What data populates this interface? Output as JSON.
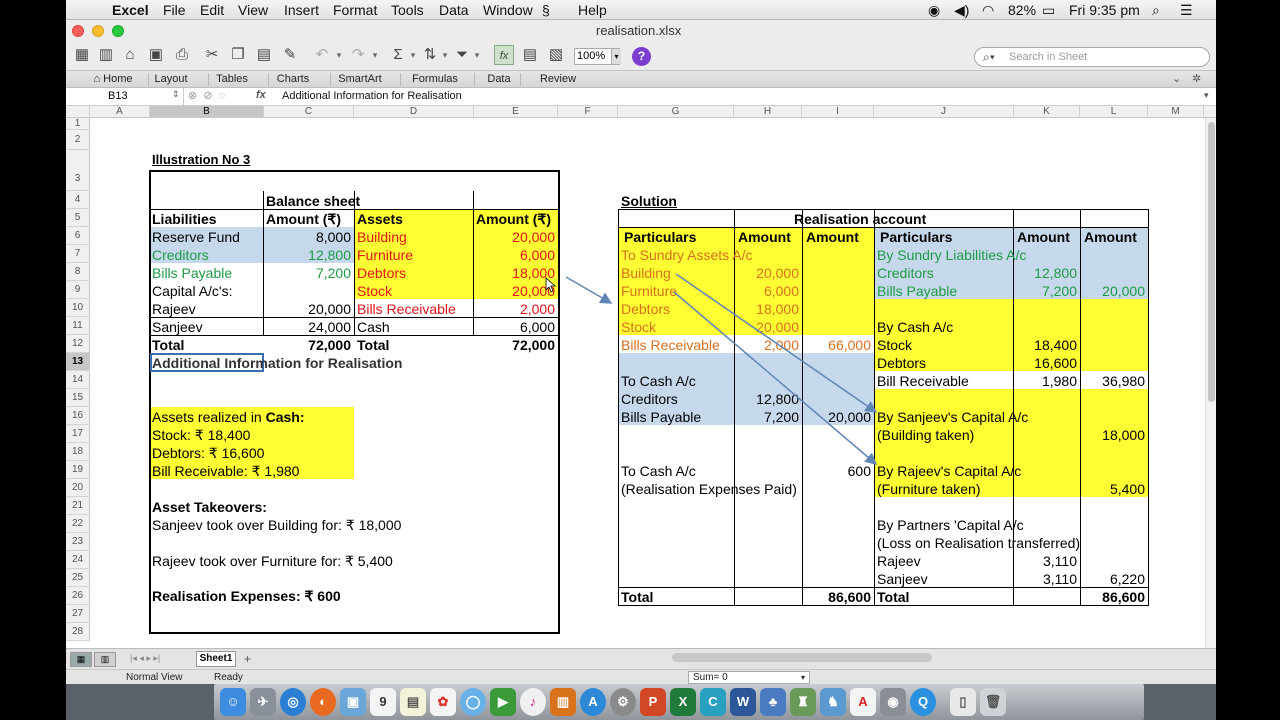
{
  "menubar": {
    "app": "Excel",
    "items": [
      "File",
      "Edit",
      "View",
      "Insert",
      "Format",
      "Tools",
      "Data",
      "Window",
      "Help"
    ],
    "battery": "82%",
    "clock": "Fri 9:35 pm"
  },
  "window": {
    "title": "realisation.xlsx"
  },
  "toolbar": {
    "zoom": "100%",
    "search_placeholder": "Search in Sheet"
  },
  "ribbon": {
    "tabs": [
      "Home",
      "Layout",
      "Tables",
      "Charts",
      "SmartArt",
      "Formulas",
      "Data",
      "Review"
    ]
  },
  "formula_bar": {
    "name_box": "B13",
    "fx": "fx",
    "content": "Additional Information for Realisation"
  },
  "columns": [
    "A",
    "B",
    "C",
    "D",
    "E",
    "F",
    "G",
    "H",
    "I",
    "J",
    "K",
    "L",
    "M"
  ],
  "rows": [
    "1",
    "2",
    "3",
    "4",
    "5",
    "6",
    "7",
    "8",
    "9",
    "10",
    "11",
    "12",
    "13",
    "14",
    "15",
    "16",
    "17",
    "18",
    "19",
    "20",
    "21",
    "22",
    "23",
    "24",
    "25",
    "26",
    "27",
    "28"
  ],
  "left": {
    "illustration": "Illustration No 3",
    "bs_title": "Balance sheet",
    "hdr_liabilities": "Liabilities",
    "hdr_amount1": "Amount (₹)",
    "hdr_assets": "Assets",
    "hdr_amount2": "Amount (₹)",
    "r5": [
      "Reserve Fund",
      "8,000",
      "Building",
      "20,000"
    ],
    "r6": [
      "Creditors",
      "12,800",
      "Furniture",
      "6,000"
    ],
    "r7": [
      "Bills Payable",
      "7,200",
      "Debtors",
      "18,000"
    ],
    "r8": [
      "Capital A/c's:",
      "",
      "Stock",
      "20,000"
    ],
    "r9": [
      "Rajeev",
      "20,000",
      "Bills Receivable",
      "2,000"
    ],
    "r10": [
      "Sanjeev",
      "24,000",
      "Cash",
      "6,000"
    ],
    "r11": [
      "Total",
      "72,000",
      "Total",
      "72,000"
    ],
    "addl_info": "Additional Information for Realisation",
    "assets_realized_pre": "Assets realized in ",
    "assets_realized_cash": "Cash:",
    "stock": "Stock: ₹ 18,400",
    "debtors": "Debtors: ₹ 16,600",
    "bill_rec": "Bill Receivable: ₹ 1,980",
    "asset_takeovers": "Asset Takeovers:",
    "sanjeev_took": "Sanjeev took over Building for: ₹ 18,000",
    "rajeev_took": "Rajeev took over Furniture for: ₹ 5,400",
    "real_exp": "Realisation Expenses: ₹ 600"
  },
  "right": {
    "solution": "Solution",
    "ra_title": "Realisation account",
    "hdr": [
      "Particulars",
      "Amount",
      "Amount",
      "Particulars",
      "Amount",
      "Amount"
    ],
    "r6": [
      "To Sundry Assets A/c",
      "",
      "",
      "By Sundry Liabilities A/c",
      "",
      ""
    ],
    "r7": [
      "Building",
      "20,000",
      "",
      "Creditors",
      "12,800",
      ""
    ],
    "r8": [
      "Furniture",
      "6,000",
      "",
      "Bills Payable",
      "7,200",
      "20,000"
    ],
    "r9": [
      "Debtors",
      "18,000",
      "",
      "",
      "",
      ""
    ],
    "r10": [
      "Stock",
      "20,000",
      "",
      "By Cash A/c",
      "",
      ""
    ],
    "r11": [
      "Bills Receivable",
      "2,000",
      "66,000",
      "Stock",
      "18,400",
      ""
    ],
    "r12": [
      "",
      "",
      "",
      "Debtors",
      "16,600",
      ""
    ],
    "r13": [
      "To Cash A/c",
      "",
      "",
      "Bill Receivable",
      "1,980",
      "36,980"
    ],
    "r14": [
      "Creditors",
      "12,800",
      "",
      "",
      "",
      ""
    ],
    "r15": [
      "Bills Payable",
      "7,200",
      "20,000",
      "By Sanjeev's Capital A/c",
      "",
      ""
    ],
    "r16": [
      "",
      "",
      "",
      "(Building taken)",
      "",
      "18,000"
    ],
    "r18": [
      "To Cash A/c",
      "",
      "600",
      "By Rajeev's Capital A/c",
      "",
      ""
    ],
    "r19": [
      "(Realisation Expenses Paid)",
      "",
      "",
      "(Furniture taken)",
      "",
      "5,400"
    ],
    "r21": [
      "",
      "",
      "",
      "By Partners 'Capital A/c",
      "",
      ""
    ],
    "r22": [
      "",
      "",
      "",
      "(Loss on Realisation transferred)",
      "",
      ""
    ],
    "r23": [
      "",
      "",
      "",
      "Rajeev",
      "3,110",
      ""
    ],
    "r24": [
      "",
      "",
      "",
      "Sanjeev",
      "3,110",
      "6,220"
    ],
    "r25": [
      "Total",
      "",
      "86,600",
      "Total",
      "",
      "86,600"
    ]
  },
  "sheet": {
    "tab": "Sheet1",
    "add": "+"
  },
  "status": {
    "view": "Normal View",
    "ready": "Ready",
    "sum": "Sum= 0"
  },
  "colors": {
    "yellow": "#ffff33",
    "blue": "#c6d9ec",
    "green": "#1e9a45",
    "red": "#e0141a",
    "orange": "#d8701c"
  }
}
